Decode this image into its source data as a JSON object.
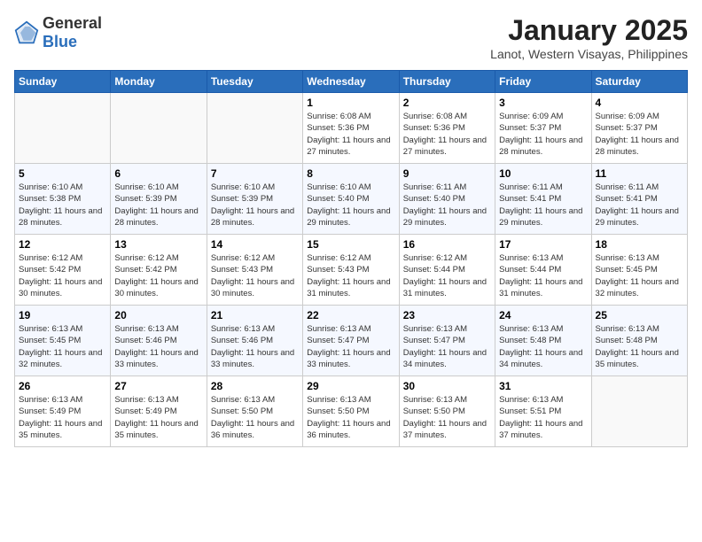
{
  "header": {
    "logo_general": "General",
    "logo_blue": "Blue",
    "month": "January 2025",
    "location": "Lanot, Western Visayas, Philippines"
  },
  "weekdays": [
    "Sunday",
    "Monday",
    "Tuesday",
    "Wednesday",
    "Thursday",
    "Friday",
    "Saturday"
  ],
  "weeks": [
    [
      {
        "day": "",
        "sunrise": "",
        "sunset": "",
        "daylight": ""
      },
      {
        "day": "",
        "sunrise": "",
        "sunset": "",
        "daylight": ""
      },
      {
        "day": "",
        "sunrise": "",
        "sunset": "",
        "daylight": ""
      },
      {
        "day": "1",
        "sunrise": "Sunrise: 6:08 AM",
        "sunset": "Sunset: 5:36 PM",
        "daylight": "Daylight: 11 hours and 27 minutes."
      },
      {
        "day": "2",
        "sunrise": "Sunrise: 6:08 AM",
        "sunset": "Sunset: 5:36 PM",
        "daylight": "Daylight: 11 hours and 27 minutes."
      },
      {
        "day": "3",
        "sunrise": "Sunrise: 6:09 AM",
        "sunset": "Sunset: 5:37 PM",
        "daylight": "Daylight: 11 hours and 28 minutes."
      },
      {
        "day": "4",
        "sunrise": "Sunrise: 6:09 AM",
        "sunset": "Sunset: 5:37 PM",
        "daylight": "Daylight: 11 hours and 28 minutes."
      }
    ],
    [
      {
        "day": "5",
        "sunrise": "Sunrise: 6:10 AM",
        "sunset": "Sunset: 5:38 PM",
        "daylight": "Daylight: 11 hours and 28 minutes."
      },
      {
        "day": "6",
        "sunrise": "Sunrise: 6:10 AM",
        "sunset": "Sunset: 5:39 PM",
        "daylight": "Daylight: 11 hours and 28 minutes."
      },
      {
        "day": "7",
        "sunrise": "Sunrise: 6:10 AM",
        "sunset": "Sunset: 5:39 PM",
        "daylight": "Daylight: 11 hours and 28 minutes."
      },
      {
        "day": "8",
        "sunrise": "Sunrise: 6:10 AM",
        "sunset": "Sunset: 5:40 PM",
        "daylight": "Daylight: 11 hours and 29 minutes."
      },
      {
        "day": "9",
        "sunrise": "Sunrise: 6:11 AM",
        "sunset": "Sunset: 5:40 PM",
        "daylight": "Daylight: 11 hours and 29 minutes."
      },
      {
        "day": "10",
        "sunrise": "Sunrise: 6:11 AM",
        "sunset": "Sunset: 5:41 PM",
        "daylight": "Daylight: 11 hours and 29 minutes."
      },
      {
        "day": "11",
        "sunrise": "Sunrise: 6:11 AM",
        "sunset": "Sunset: 5:41 PM",
        "daylight": "Daylight: 11 hours and 29 minutes."
      }
    ],
    [
      {
        "day": "12",
        "sunrise": "Sunrise: 6:12 AM",
        "sunset": "Sunset: 5:42 PM",
        "daylight": "Daylight: 11 hours and 30 minutes."
      },
      {
        "day": "13",
        "sunrise": "Sunrise: 6:12 AM",
        "sunset": "Sunset: 5:42 PM",
        "daylight": "Daylight: 11 hours and 30 minutes."
      },
      {
        "day": "14",
        "sunrise": "Sunrise: 6:12 AM",
        "sunset": "Sunset: 5:43 PM",
        "daylight": "Daylight: 11 hours and 30 minutes."
      },
      {
        "day": "15",
        "sunrise": "Sunrise: 6:12 AM",
        "sunset": "Sunset: 5:43 PM",
        "daylight": "Daylight: 11 hours and 31 minutes."
      },
      {
        "day": "16",
        "sunrise": "Sunrise: 6:12 AM",
        "sunset": "Sunset: 5:44 PM",
        "daylight": "Daylight: 11 hours and 31 minutes."
      },
      {
        "day": "17",
        "sunrise": "Sunrise: 6:13 AM",
        "sunset": "Sunset: 5:44 PM",
        "daylight": "Daylight: 11 hours and 31 minutes."
      },
      {
        "day": "18",
        "sunrise": "Sunrise: 6:13 AM",
        "sunset": "Sunset: 5:45 PM",
        "daylight": "Daylight: 11 hours and 32 minutes."
      }
    ],
    [
      {
        "day": "19",
        "sunrise": "Sunrise: 6:13 AM",
        "sunset": "Sunset: 5:45 PM",
        "daylight": "Daylight: 11 hours and 32 minutes."
      },
      {
        "day": "20",
        "sunrise": "Sunrise: 6:13 AM",
        "sunset": "Sunset: 5:46 PM",
        "daylight": "Daylight: 11 hours and 33 minutes."
      },
      {
        "day": "21",
        "sunrise": "Sunrise: 6:13 AM",
        "sunset": "Sunset: 5:46 PM",
        "daylight": "Daylight: 11 hours and 33 minutes."
      },
      {
        "day": "22",
        "sunrise": "Sunrise: 6:13 AM",
        "sunset": "Sunset: 5:47 PM",
        "daylight": "Daylight: 11 hours and 33 minutes."
      },
      {
        "day": "23",
        "sunrise": "Sunrise: 6:13 AM",
        "sunset": "Sunset: 5:47 PM",
        "daylight": "Daylight: 11 hours and 34 minutes."
      },
      {
        "day": "24",
        "sunrise": "Sunrise: 6:13 AM",
        "sunset": "Sunset: 5:48 PM",
        "daylight": "Daylight: 11 hours and 34 minutes."
      },
      {
        "day": "25",
        "sunrise": "Sunrise: 6:13 AM",
        "sunset": "Sunset: 5:48 PM",
        "daylight": "Daylight: 11 hours and 35 minutes."
      }
    ],
    [
      {
        "day": "26",
        "sunrise": "Sunrise: 6:13 AM",
        "sunset": "Sunset: 5:49 PM",
        "daylight": "Daylight: 11 hours and 35 minutes."
      },
      {
        "day": "27",
        "sunrise": "Sunrise: 6:13 AM",
        "sunset": "Sunset: 5:49 PM",
        "daylight": "Daylight: 11 hours and 35 minutes."
      },
      {
        "day": "28",
        "sunrise": "Sunrise: 6:13 AM",
        "sunset": "Sunset: 5:50 PM",
        "daylight": "Daylight: 11 hours and 36 minutes."
      },
      {
        "day": "29",
        "sunrise": "Sunrise: 6:13 AM",
        "sunset": "Sunset: 5:50 PM",
        "daylight": "Daylight: 11 hours and 36 minutes."
      },
      {
        "day": "30",
        "sunrise": "Sunrise: 6:13 AM",
        "sunset": "Sunset: 5:50 PM",
        "daylight": "Daylight: 11 hours and 37 minutes."
      },
      {
        "day": "31",
        "sunrise": "Sunrise: 6:13 AM",
        "sunset": "Sunset: 5:51 PM",
        "daylight": "Daylight: 11 hours and 37 minutes."
      },
      {
        "day": "",
        "sunrise": "",
        "sunset": "",
        "daylight": ""
      }
    ]
  ]
}
